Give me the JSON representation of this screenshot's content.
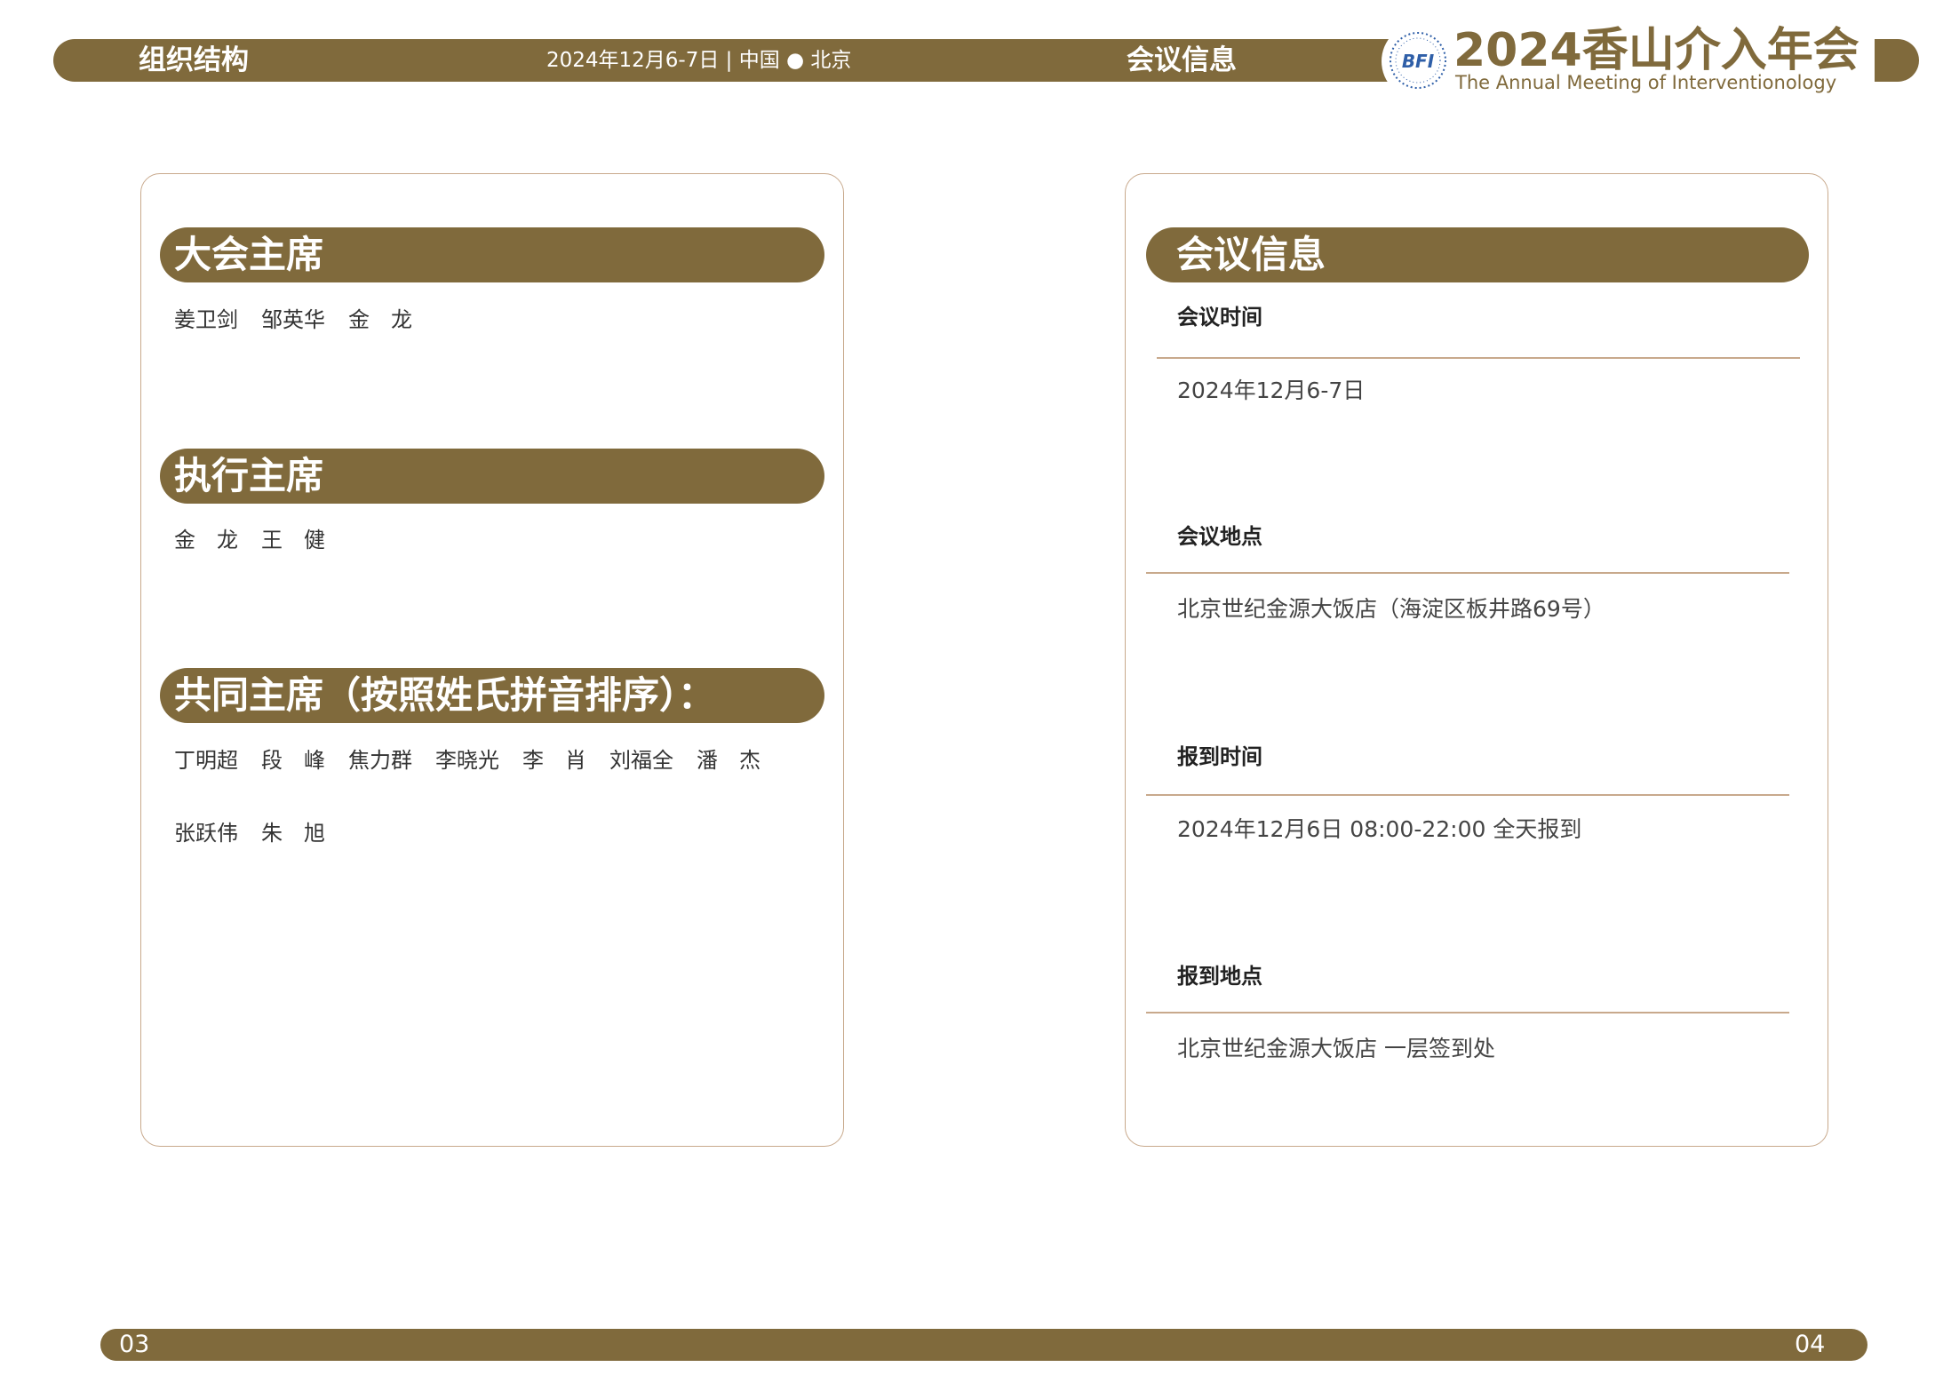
{
  "header": {
    "left_title": "组织结构",
    "date_place": "2024年12月6-7日 | 中国 ● 北京",
    "mid_title": "会议信息",
    "logo_badge_text": "BFI",
    "logo_title": "2024香山介入年会",
    "logo_subtitle": "The Annual Meeting of Interventionology"
  },
  "left_card": {
    "sections": [
      {
        "title": "大会主席",
        "lines": [
          [
            "姜卫剑",
            "邹英华",
            "金　龙"
          ]
        ]
      },
      {
        "title": "执行主席",
        "lines": [
          [
            "金　龙",
            "王　健"
          ]
        ]
      },
      {
        "title": "共同主席（按照姓氏拼音排序）：",
        "lines": [
          [
            "丁明超",
            "段　峰",
            "焦力群",
            "李晓光",
            "李　肖",
            "刘福全",
            "潘　杰"
          ],
          [
            "张跃伟",
            "朱　旭"
          ]
        ]
      }
    ]
  },
  "right_card": {
    "title": "会议信息",
    "items": [
      {
        "label": "会议时间",
        "value": "2024年12月6-7日"
      },
      {
        "label": "会议地点",
        "value": "北京世纪金源大饭店（海淀区板井路69号）"
      },
      {
        "label": "报到时间",
        "value": "2024年12月6日 08:00-22:00 全天报到"
      },
      {
        "label": "报到地点",
        "value": "北京世纪金源大饭店 一层签到处"
      }
    ]
  },
  "footer": {
    "left_page": "03",
    "right_page": "04"
  },
  "colors": {
    "accent": "#806a3c",
    "border": "#c8a98c"
  }
}
